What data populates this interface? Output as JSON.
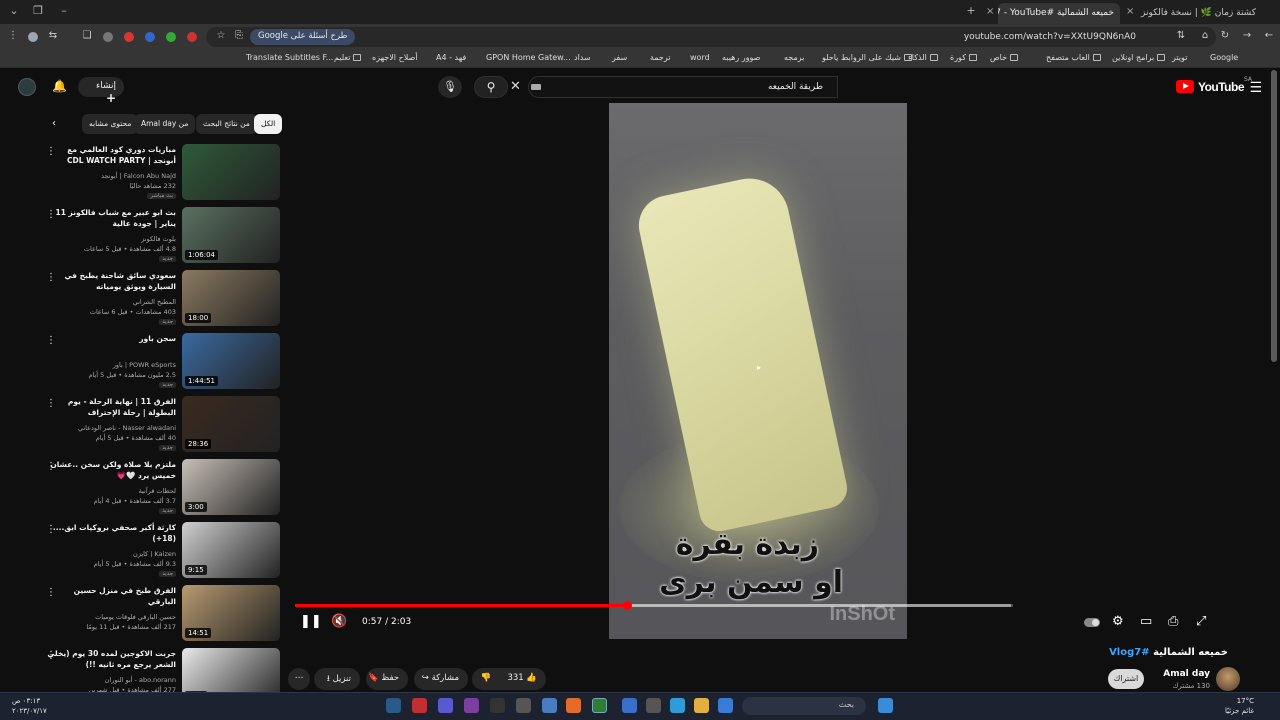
{
  "browser": {
    "tabs": [
      {
        "label": "كشتة زمان 🌿 | نسخة فالكونز",
        "active": false
      },
      {
        "label": "خميعه الشمالية #Vlog7 - YouTube",
        "active": true
      }
    ],
    "url": "youtube.com/watch?v=XXtU9QN6nA0",
    "google_pill": "طرح أسئلة على Google",
    "bookmarks": [
      "Google",
      "تويتر",
      "برامج اونلاين",
      "العاب متصفح",
      "خاص",
      "كورة",
      "الذكاء",
      "شيك على الروابط ياحلو",
      "برمجه",
      "صوور رهيبه",
      "word",
      "ترجمة",
      "سفر",
      "سداد",
      "GPON Home Gatew...",
      "فهد - A4",
      "أصلاح الاجهزه",
      "تعليم",
      "Translate Subtitles F..."
    ]
  },
  "youtube": {
    "logo": "YouTube",
    "region": "SA",
    "search_query": "طريقة الخميعه",
    "create_label": "إنشاء"
  },
  "player": {
    "caption_line1": "زبدة بقرة",
    "caption_line2": "او سمن برى",
    "watermark": "InShOt",
    "current_time": "0:57",
    "duration": "2:03",
    "time_display": "0:57 / 2:03",
    "progress_fraction": 0.463,
    "buffered_fraction": 0.997,
    "accent": "#ff0000"
  },
  "video": {
    "title": "خميعه الشمالية",
    "hashtag": "#Vlog7",
    "channel": "Amal day",
    "subscribers": "130 مشترك",
    "subscribe_label": "اشتراك",
    "likes": "331",
    "share_label": "مشاركة",
    "save_label": "حفظ",
    "download_label": "تنزيل"
  },
  "sidebar": {
    "chips": [
      "الكل",
      "من نتائج البحث",
      "من Amal day",
      "محتوى مشابه"
    ],
    "recommendations": [
      {
        "title": "مباريات دوري كود العالمي مع أبونجد | CDL WATCH PARTY",
        "channel": "Falcon Abu Najd | أبونجد",
        "meta": "232 مشاهد حاليًا",
        "duration": "",
        "badge": "بث مباشر"
      },
      {
        "title": "بث ابو عبير مع شباب فالكونز 11 يناير | جودة عالية",
        "channel": "بلوت فالكونز",
        "meta": "4.8 ألف مشاهدة • قبل 5 ساعات",
        "duration": "1:06:04",
        "badge": "جديد"
      },
      {
        "title": "سعودي سائق شاحنة يطبخ في السيارة ويوثق يومياته",
        "channel": "المطبخ الشراني",
        "meta": "403 مشاهدات • قبل 6 ساعات",
        "duration": "18:00",
        "badge": "جديد"
      },
      {
        "title": "سجن باور",
        "channel": "POWR eSports | باور",
        "meta": "2.5 مليون مشاهدة • قبل 5 أيام",
        "duration": "1:44:51",
        "badge": "جديد"
      },
      {
        "title": "الفرق 11 | نهاية الرحلة - يوم البطولة | رحلة الإحتراف",
        "channel": "Nasser alwadani - ناصر الودعاني",
        "meta": "40 ألف مشاهدة • قبل 5 أيام",
        "duration": "28:36",
        "badge": "جديد"
      },
      {
        "title": "ملتزم بلا صلاة ولكن سخن ..عشان خميس يرد 🤍💗",
        "channel": "لحظات قرآنية",
        "meta": "3.7 ألف مشاهدة • قبل 4 أيام",
        "duration": "3:00",
        "badge": "جديد"
      },
      {
        "title": "كارثة أكبر صحفي بروكيات ابق.... (18+)",
        "channel": "Kaizen | كايزن",
        "meta": "9.3 ألف مشاهدة • قبل 5 أيام",
        "duration": "9:15",
        "badge": "جديد"
      },
      {
        "title": "الفرق طبخ في منزل حسين البارقي",
        "channel": "حسين البارقي فلوقات يوميات",
        "meta": "217 ألف مشاهدة • قبل 11 يومًا",
        "duration": "14:51",
        "badge": ""
      },
      {
        "title": "جربت الاكوجين لمده 30 يوم (يخلي الشعر يرجع مره ثانيه !!)",
        "channel": "abo.norann - أبو النوران",
        "meta": "277 ألف مشاهدة • قبل شهرين",
        "duration": "8:56",
        "badge": ""
      }
    ],
    "thumb_colors": [
      "#2f5a3a",
      "#5a7060",
      "#8a7a60",
      "#3a6aa0",
      "#3a2a20",
      "#c8c0b8",
      "#d0d0d0",
      "#b89a70",
      "#eaeaea"
    ]
  },
  "taskbar": {
    "search_placeholder": "بحث",
    "time": "٠٣:١٣ ص",
    "date": "٢٠٢٣/٠٧/١٧",
    "temperature": "17°C",
    "weather_text": "غائم جزئيًا"
  }
}
